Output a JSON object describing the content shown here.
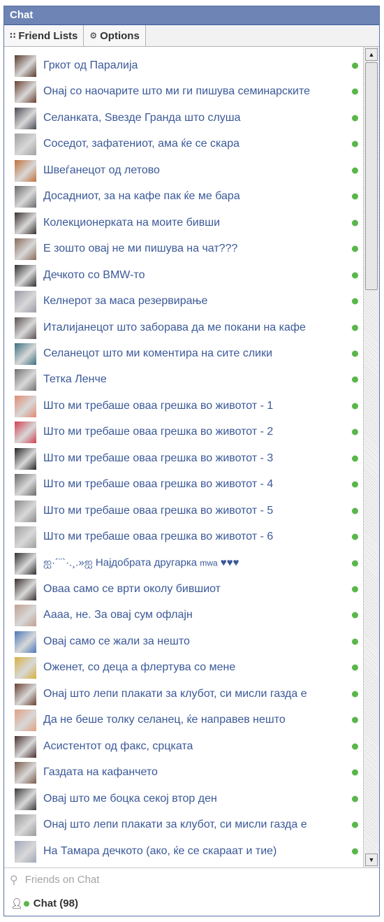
{
  "window": {
    "title": "Chat"
  },
  "toolbar": {
    "friend_lists": {
      "icon": "grid-icon",
      "label": "Friend Lists"
    },
    "options": {
      "icon": "gear-icon",
      "label": "Options"
    }
  },
  "colors": {
    "online": "#5ab64a",
    "link": "#3b5998",
    "title_bar": "#6d84b4"
  },
  "friends": [
    {
      "name": "Гркот од Паралија",
      "avatar": "#5a3a2a"
    },
    {
      "name": "Онај со наочарите што ми ги пишува семинарските",
      "avatar": "#6a4030"
    },
    {
      "name": "Селанката, Ѕвезде Гранда што слуша",
      "avatar": "#4a4a55"
    },
    {
      "name": "Соседот, зафатениот, ама ќе се скара",
      "avatar": "#a0a0a0"
    },
    {
      "name": "Швеѓанецот од летово",
      "avatar": "#c0703a"
    },
    {
      "name": "Досадниот, за на кафе пак ќе ме бара",
      "avatar": "#6a6a6a"
    },
    {
      "name": "Колекционерката на моите бивши",
      "avatar": "#3a3030"
    },
    {
      "name": "Е зошто овај не ми пишува на чат???",
      "avatar": "#8a6a5a"
    },
    {
      "name": "Дечкото со BMW-то",
      "avatar": "#303030"
    },
    {
      "name": "Келнерот за маса резервирање",
      "avatar": "#9a9aa8"
    },
    {
      "name": "Италијанецот што заборава да ме покани на кафе",
      "avatar": "#5a5050"
    },
    {
      "name": "Селанецот што ми коментира на сите слики",
      "avatar": "#3a7080"
    },
    {
      "name": "Тетка Ленче",
      "avatar": "#707070"
    },
    {
      "name": "Што ми требаше оваа грешка во животот - 1",
      "avatar": "#e08a70"
    },
    {
      "name": "Што ми требаше оваа грешка во животот - 2",
      "avatar": "#d04050"
    },
    {
      "name": "Што ми требаше оваа грешка во животот - 3",
      "avatar": "#252525"
    },
    {
      "name": "Што ми требаше оваа грешка во животот - 4",
      "avatar": "#6a6a6a"
    },
    {
      "name": "Што ми требаше оваа грешка во животот - 5",
      "avatar": "#8a8a8a"
    },
    {
      "name": "Што ми требаше оваа грешка во животот - 6",
      "avatar": "#a0a0a0"
    },
    {
      "name": "ஐ·´¨`·.¸.»ஐ   Најдобрата другарка",
      "suffix_small": "mwa",
      "suffix": " ♥♥♥",
      "avatar": "#303030",
      "special": true
    },
    {
      "name": "Оваа само се врти околу бившиот",
      "avatar": "#3a3030"
    },
    {
      "name": "Аааа, не. За овај сум офлајн",
      "avatar": "#c0a090"
    },
    {
      "name": "Овај само се жали за нешто",
      "avatar": "#4a78b8"
    },
    {
      "name": "Оженет, со деца а флертува со мене",
      "avatar": "#d8b040"
    },
    {
      "name": "Онај што лепи плакати за клубот, си мисли газда е",
      "avatar": "#6a4030"
    },
    {
      "name": "Да не беше толку селанец, ќе направев нешто",
      "avatar": "#e0a080"
    },
    {
      "name": "Асистентот од факс, срцката",
      "avatar": "#4a3030"
    },
    {
      "name": "Газдата на кафанчето",
      "avatar": "#7a5a4a"
    },
    {
      "name": "Овај што ме боцка секој втор ден",
      "avatar": "#3a3a3a"
    },
    {
      "name": "Онај што лепи плакати за клубот, си мисли газда е",
      "avatar": "#9a9a9a"
    },
    {
      "name": "На Тамара дечкото (ако, ќе се скараат и тие)",
      "avatar": "#a0a8b8"
    }
  ],
  "scroll": {
    "up_icon": "▲",
    "down_icon": "▼"
  },
  "search": {
    "icon": "search-icon",
    "placeholder": "Friends on Chat"
  },
  "footer": {
    "icon": "person-online-icon",
    "label": "Chat (98)"
  }
}
